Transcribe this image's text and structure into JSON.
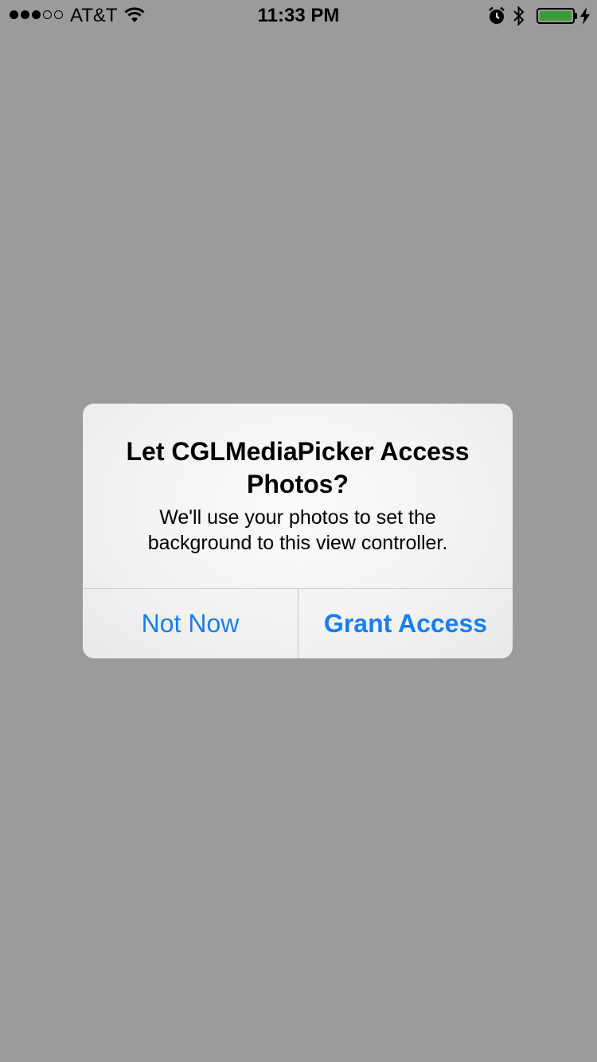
{
  "status_bar": {
    "signal_strength": {
      "filled": 3,
      "total": 5
    },
    "carrier": "AT&T",
    "time": "11:33 PM",
    "battery_level": 1.0,
    "icons": [
      "wifi-icon",
      "alarm-icon",
      "bluetooth-icon",
      "battery-icon",
      "charging-icon"
    ]
  },
  "alert": {
    "title": "Let CGLMediaPicker Access Photos?",
    "message": "We'll use your photos to set the background to this view controller.",
    "cancel_label": "Not Now",
    "confirm_label": "Grant Access"
  },
  "colors": {
    "background": "#9b9b9b",
    "button_text": "#1a7ef0",
    "battery": "#3a9b3a"
  }
}
